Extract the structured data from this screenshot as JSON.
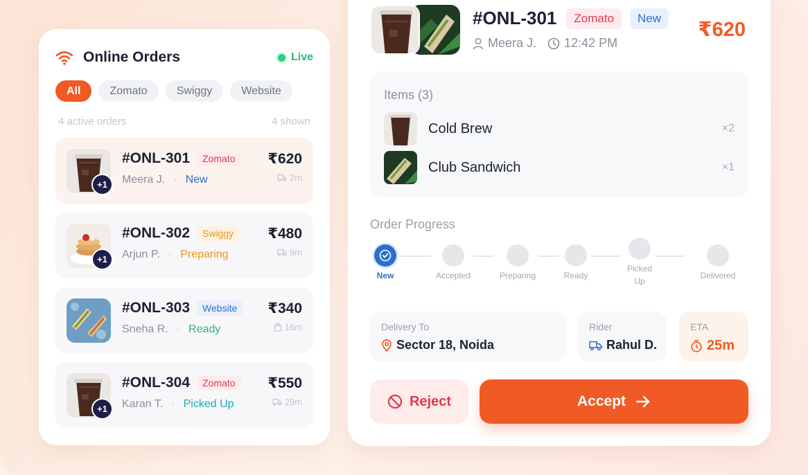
{
  "colors": {
    "accent": "#f05a24",
    "live": "#2bd07f",
    "new": "#2d6fcf"
  },
  "left": {
    "title": "Online Orders",
    "live_label": "Live",
    "filters": [
      "All",
      "Zomato",
      "Swiggy",
      "Website"
    ],
    "active_count": "4 active orders",
    "shown_count": "4 shown",
    "orders": [
      {
        "id": "#ONL-301",
        "source": "Zomato",
        "customer": "Meera J.",
        "status": "New",
        "price": "₹620",
        "time": "2m",
        "extra": "+1",
        "icon": "truck-icon"
      },
      {
        "id": "#ONL-302",
        "source": "Swiggy",
        "customer": "Arjun P.",
        "status": "Preparing",
        "price": "₹480",
        "time": "9m",
        "extra": "+1",
        "icon": "truck-icon"
      },
      {
        "id": "#ONL-303",
        "source": "Website",
        "customer": "Sneha R.",
        "status": "Ready",
        "price": "₹340",
        "time": "16m",
        "extra": "",
        "icon": "bag-icon"
      },
      {
        "id": "#ONL-304",
        "source": "Zomato",
        "customer": "Karan T.",
        "status": "Picked Up",
        "price": "₹550",
        "time": "29m",
        "extra": "+1",
        "icon": "truck-icon"
      }
    ]
  },
  "detail": {
    "id": "#ONL-301",
    "source": "Zomato",
    "status": "New",
    "customer": "Meera J.",
    "time": "12:42 PM",
    "total": "₹620",
    "items_label": "Items (3)",
    "items": [
      {
        "name": "Cold Brew",
        "qty": "×2"
      },
      {
        "name": "Club Sandwich",
        "qty": "×1"
      }
    ],
    "progress_label": "Order Progress",
    "steps": [
      "New",
      "Accepted",
      "Preparing",
      "Ready",
      "Picked Up",
      "Delivered"
    ],
    "delivery_label": "Delivery To",
    "delivery_value": "Sector 18, Noida",
    "rider_label": "Rider",
    "rider_value": "Rahul D.",
    "eta_label": "ETA",
    "eta_value": "25m",
    "reject_label": "Reject",
    "accept_label": "Accept"
  }
}
